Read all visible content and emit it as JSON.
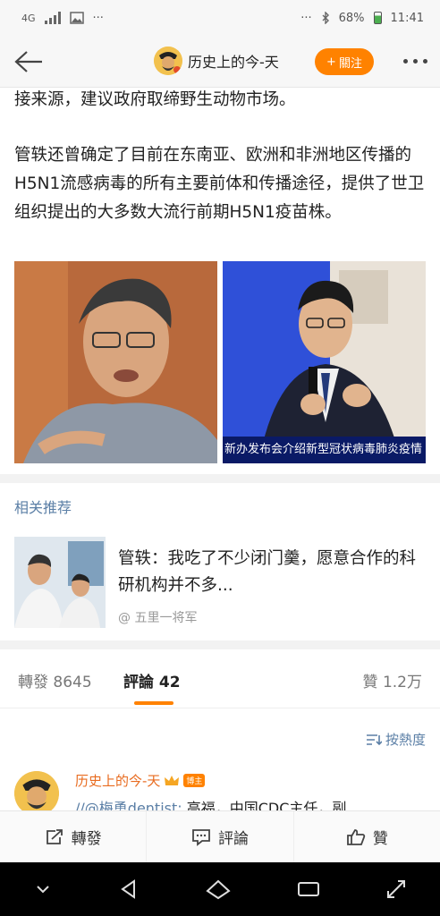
{
  "status": {
    "signal": "4G",
    "time": "11:41",
    "battery": "68%",
    "dots": "···"
  },
  "nav": {
    "title": "历史上的今-天",
    "follow_label": "關注",
    "follow_plus": "+"
  },
  "article": {
    "p1": "接来源，建议政府取缔野生动物市场。",
    "p2": "管轶还曾确定了目前在东南亚、欧洲和非洲地区传播的H5N1流感病毒的所有主要前体和传播途径，提供了世卫组织提出的大多数大流行前期H5N1疫苗株。",
    "photo_caption": "新办发布会介绍新型冠状病毒肺炎疫情"
  },
  "related": {
    "section_title": "相关推荐",
    "card_title": "管轶：我吃了不少闭门羹，愿意合作的科研机构并不多...",
    "card_author": "@ 五里一将军"
  },
  "tabs": [
    {
      "label": "轉發",
      "count": "8645"
    },
    {
      "label": "評論",
      "count": "42"
    },
    {
      "label": "贊",
      "count": "1.2万"
    }
  ],
  "sort_label": "按熱度",
  "comment": {
    "name": "历史上的今-天",
    "badge": "博主",
    "mention": "//@梅勇dentist:",
    "text": " 高福，中国CDC主任，副"
  },
  "actions": {
    "repost": "轉發",
    "comment": "評論",
    "like": "贊"
  },
  "colors": {
    "accent": "#ff8200",
    "link": "#5b7fa6"
  }
}
